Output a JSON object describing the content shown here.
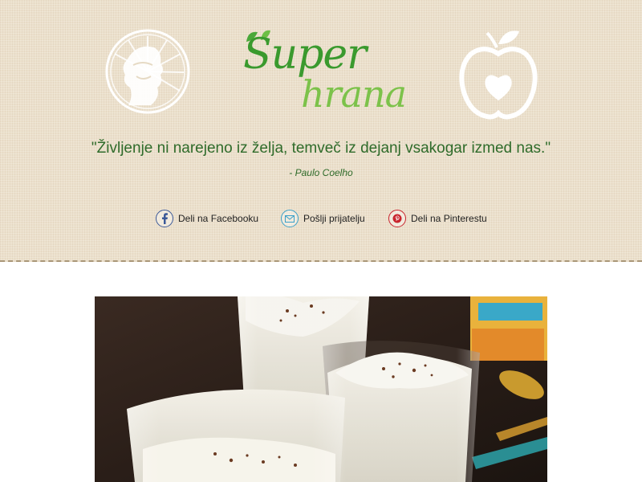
{
  "logo": {
    "line1": "Super",
    "line2": "hrana"
  },
  "quote": {
    "text": "\"Življenje ni narejeno iz želja, temveč iz dejanj vsakogar izmed nas.\"",
    "author": "- Paulo Coelho"
  },
  "share": [
    {
      "label": "Deli na Facebooku",
      "icon": "facebook-icon",
      "color": "#3b5998"
    },
    {
      "label": "Pošlji prijatelju",
      "icon": "envelope-icon",
      "color": "#3aa0c8"
    },
    {
      "label": "Deli na Pinterestu",
      "icon": "pinterest-icon",
      "color": "#c8232c"
    }
  ],
  "colors": {
    "header_bg": "#ebe0cc",
    "brand_green": "#3a9a2e",
    "brand_light_green": "#7cc24a",
    "quote_green": "#2f6b2a"
  },
  "hero_image": "dessert-glasses-photo"
}
